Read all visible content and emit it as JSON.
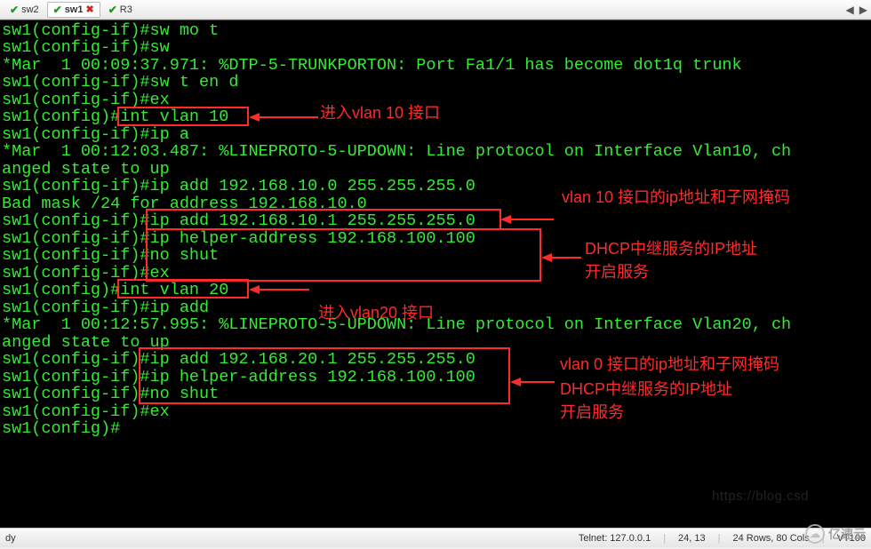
{
  "tabs": {
    "t0": "sw2",
    "t1": "sw1",
    "t2": "R3"
  },
  "term": {
    "l1": "sw1(config-if)#sw mo t",
    "l2": "sw1(config-if)#sw",
    "l3": "*Mar  1 00:09:37.971: %DTP-5-TRUNKPORTON: Port Fa1/1 has become dot1q trunk",
    "l4": "sw1(config-if)#sw t en d",
    "l5": "sw1(config-if)#ex",
    "l6": "sw1(config)#int vlan 10",
    "l7": "sw1(config-if)#ip a",
    "l8": "*Mar  1 00:12:03.487: %LINEPROTO-5-UPDOWN: Line protocol on Interface Vlan10, ch",
    "l9": "anged state to up",
    "l10": "sw1(config-if)#ip add 192.168.10.0 255.255.255.0",
    "l11": "Bad mask /24 for address 192.168.10.0",
    "l12": "sw1(config-if)#ip add 192.168.10.1 255.255.255.0",
    "l13": "sw1(config-if)#ip helper-address 192.168.100.100",
    "l14": "sw1(config-if)#no shut",
    "l15": "sw1(config-if)#ex",
    "l16": "sw1(config)#int vlan 20",
    "l17": "sw1(config-if)#ip add",
    "l18": "*Mar  1 00:12:57.995: %LINEPROTO-5-UPDOWN: Line protocol on Interface Vlan20, ch",
    "l19": "anged state to up",
    "l20": "sw1(config-if)#ip add 192.168.20.1 255.255.255.0",
    "l21": "sw1(config-if)#ip helper-address 192.168.100.100",
    "l22": "sw1(config-if)#no shut",
    "l23": "sw1(config-if)#ex",
    "l24": "sw1(config)#"
  },
  "annotations": {
    "a1": "进入vlan 10 接口",
    "a2": "vlan 10 接口的ip地址和子网掩码",
    "a3": "DHCP中继服务的IP地址",
    "a3b": "开启服务",
    "a4": "进入vlan20 接口",
    "a5": "vlan 0 接口的ip地址和子网掩码",
    "a6": "DHCP中继服务的IP地址",
    "a6b": "开启服务"
  },
  "status": {
    "left": "dy",
    "telnet": "Telnet: 127.0.0.1",
    "pos": "24, 13",
    "size": "24 Rows, 80 Cols",
    "emul": "VT100"
  },
  "watermark": "亿速云",
  "faded_url": "https://blog.csd"
}
